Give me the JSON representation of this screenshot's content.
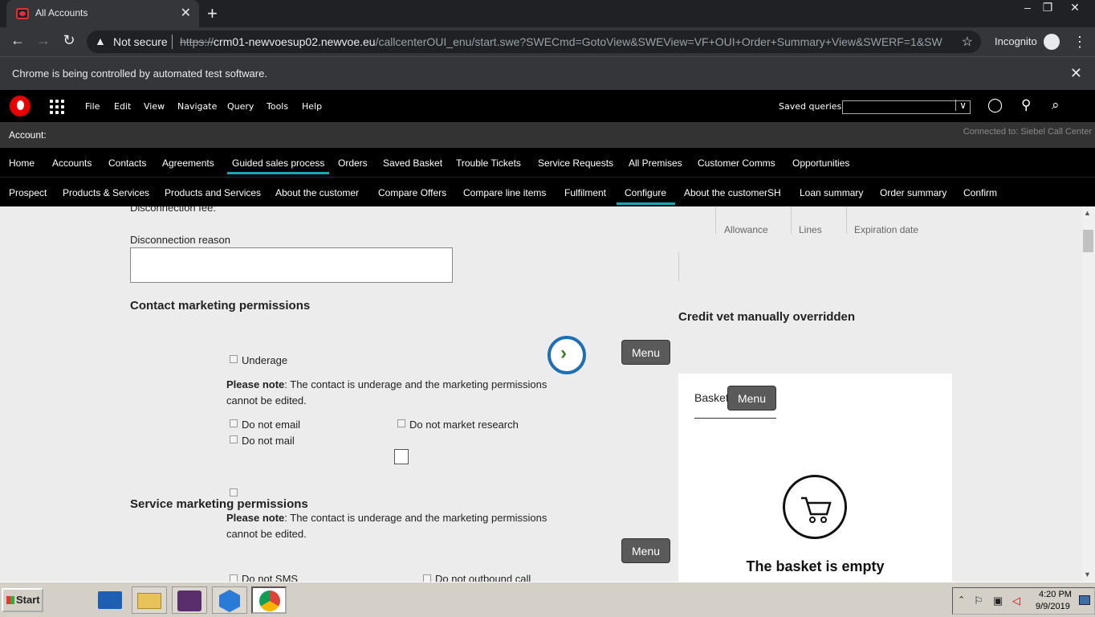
{
  "browser": {
    "tab_title": "All Accounts",
    "tab_close": "✕",
    "new_tab": "+",
    "security": "Not secure",
    "url_prefix": "https://",
    "url_host": "crm01-newvoesup02.newvoe.eu",
    "url_path": "/callcenterOUI_enu/start.swe?SWECmd=GotoView&SWEView=VF+OUI+Order+Summary+View&SWERF=1&SW...",
    "incognito": "Incognito",
    "infobar": "Chrome is being controlled by automated test software.",
    "window_controls": [
      "–",
      "❐",
      "✕"
    ]
  },
  "app": {
    "menu": [
      "File",
      "Edit",
      "View",
      "Navigate",
      "Query",
      "Tools",
      "Help"
    ],
    "saved_queries_label": "Saved queries",
    "saved_queries_value": "",
    "account_label": "Account:",
    "connected": "Connected to: Siebel Call Center",
    "tabs_primary": [
      "Home",
      "Accounts",
      "Contacts",
      "Agreements",
      "Guided sales process",
      "Orders",
      "Saved Basket",
      "Trouble Tickets",
      "Service Requests",
      "All Premises",
      "Customer Comms",
      "Opportunities"
    ],
    "tabs_secondary": [
      "Prospect",
      "Products & Services",
      "Products and Services",
      "About the customer",
      "Compare Offers",
      "Compare line items",
      "Fulfilment",
      "Configure",
      "About the customerSH",
      "Loan summary",
      "Order summary",
      "Confirm"
    ],
    "active_primary": "Guided sales process",
    "active_secondary": "Configure"
  },
  "form": {
    "disconnection_fee_label": "Disconnection fee:",
    "disconnection_reason_label": "Disconnection reason",
    "disconnection_reason_value": "",
    "contact_marketing_heading": "Contact marketing permissions",
    "underage_label": "Underage",
    "note_bold": "Please note",
    "note_line1": ": The contact is underage and the marketing permissions",
    "note_line2": "cannot be edited.",
    "do_not_email": "Do not email",
    "do_not_market_research": "Do not market research",
    "do_not_mail": "Do not mail",
    "service_marketing_heading": "Service marketing permissions",
    "service_note_bold": "Please note",
    "service_note_line1": ": The contact is underage and the marketing permissions",
    "service_note_line2": "cannot be edited.",
    "do_not_sms": "Do not SMS",
    "do_not_outbound_call": "Do not outbound call",
    "menu_button": "Menu"
  },
  "right": {
    "columns": [
      "Allowance",
      "Lines",
      "Expiration date"
    ],
    "credit_vet": "Credit vet manually overridden",
    "basket_tab": "Basket",
    "basket_menu": "Menu",
    "basket_empty": "The basket is empty"
  },
  "taskbar": {
    "start": "Start",
    "time": "4:20 PM",
    "date": "9/9/2019"
  }
}
